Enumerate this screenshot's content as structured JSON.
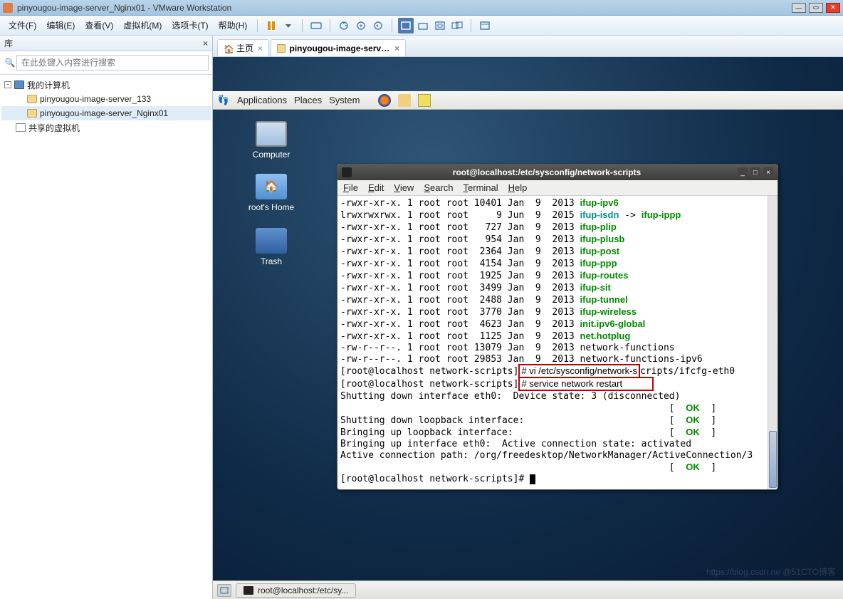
{
  "window": {
    "title": "pinyougou-image-server_Nginx01 - VMware Workstation"
  },
  "menu": {
    "file": "文件(F)",
    "edit": "编辑(E)",
    "view": "查看(V)",
    "vm": "虚拟机(M)",
    "tabs": "选项卡(T)",
    "help": "帮助(H)"
  },
  "sidebar": {
    "header": "库",
    "search_placeholder": "在此处键入内容进行搜索",
    "root": "我的计算机",
    "vm1": "pinyougou-image-server_133",
    "vm2": "pinyougou-image-server_Nginx01",
    "shared": "共享的虚拟机"
  },
  "tabs": {
    "home_label": "主页",
    "vm_label": "pinyougou-image-server..."
  },
  "gnome_panel": {
    "apps": "Applications",
    "places": "Places",
    "system": "System"
  },
  "desktop": {
    "computer": "Computer",
    "home": "root's Home",
    "trash": "Trash"
  },
  "terminal": {
    "title": "root@localhost:/etc/sysconfig/network-scripts",
    "menu": {
      "file": "File",
      "edit": "Edit",
      "view": "View",
      "search": "Search",
      "terminal": "Terminal",
      "help": "Help"
    },
    "listing": [
      {
        "perm": "-rwxr-xr-x.",
        "n": "1",
        "u": "root",
        "g": "root",
        "size": "10401",
        "mon": "Jan",
        "day": " 9",
        "yr": "2013",
        "name": "ifup-ipv6",
        "type": "exec"
      },
      {
        "perm": "lrwxrwxrwx.",
        "n": "1",
        "u": "root",
        "g": "root",
        "size": "    9",
        "mon": "Jun",
        "day": " 9",
        "yr": "2015",
        "name": "ifup-isdn",
        "type": "link",
        "target": "ifup-ippp"
      },
      {
        "perm": "-rwxr-xr-x.",
        "n": "1",
        "u": "root",
        "g": "root",
        "size": "  727",
        "mon": "Jan",
        "day": " 9",
        "yr": "2013",
        "name": "ifup-plip",
        "type": "exec"
      },
      {
        "perm": "-rwxr-xr-x.",
        "n": "1",
        "u": "root",
        "g": "root",
        "size": "  954",
        "mon": "Jan",
        "day": " 9",
        "yr": "2013",
        "name": "ifup-plusb",
        "type": "exec"
      },
      {
        "perm": "-rwxr-xr-x.",
        "n": "1",
        "u": "root",
        "g": "root",
        "size": " 2364",
        "mon": "Jan",
        "day": " 9",
        "yr": "2013",
        "name": "ifup-post",
        "type": "exec"
      },
      {
        "perm": "-rwxr-xr-x.",
        "n": "1",
        "u": "root",
        "g": "root",
        "size": " 4154",
        "mon": "Jan",
        "day": " 9",
        "yr": "2013",
        "name": "ifup-ppp",
        "type": "exec"
      },
      {
        "perm": "-rwxr-xr-x.",
        "n": "1",
        "u": "root",
        "g": "root",
        "size": " 1925",
        "mon": "Jan",
        "day": " 9",
        "yr": "2013",
        "name": "ifup-routes",
        "type": "exec"
      },
      {
        "perm": "-rwxr-xr-x.",
        "n": "1",
        "u": "root",
        "g": "root",
        "size": " 3499",
        "mon": "Jan",
        "day": " 9",
        "yr": "2013",
        "name": "ifup-sit",
        "type": "exec"
      },
      {
        "perm": "-rwxr-xr-x.",
        "n": "1",
        "u": "root",
        "g": "root",
        "size": " 2488",
        "mon": "Jan",
        "day": " 9",
        "yr": "2013",
        "name": "ifup-tunnel",
        "type": "exec"
      },
      {
        "perm": "-rwxr-xr-x.",
        "n": "1",
        "u": "root",
        "g": "root",
        "size": " 3770",
        "mon": "Jan",
        "day": " 9",
        "yr": "2013",
        "name": "ifup-wireless",
        "type": "exec"
      },
      {
        "perm": "-rwxr-xr-x.",
        "n": "1",
        "u": "root",
        "g": "root",
        "size": " 4623",
        "mon": "Jan",
        "day": " 9",
        "yr": "2013",
        "name": "init.ipv6-global",
        "type": "exec"
      },
      {
        "perm": "-rwxr-xr-x.",
        "n": "1",
        "u": "root",
        "g": "root",
        "size": " 1125",
        "mon": "Jan",
        "day": " 9",
        "yr": "2013",
        "name": "net.hotplug",
        "type": "exec"
      },
      {
        "perm": "-rw-r--r--.",
        "n": "1",
        "u": "root",
        "g": "root",
        "size": "13079",
        "mon": "Jan",
        "day": " 9",
        "yr": "2013",
        "name": "network-functions",
        "type": "file"
      },
      {
        "perm": "-rw-r--r--.",
        "n": "1",
        "u": "root",
        "g": "root",
        "size": "29853",
        "mon": "Jan",
        "day": " 9",
        "yr": "2013",
        "name": "network-functions-ipv6",
        "type": "file"
      }
    ],
    "prompt1": "[root@localhost network-scripts]",
    "cmd1_tail": "cripts/ifcfg-eth0",
    "prompt2": "[root@localhost network-scripts]",
    "cmd2": "# service network restart",
    "out1": "Shutting down interface eth0:  Device state: 3 (disconnected)",
    "ok": "OK",
    "out2": "Shutting down loopback interface:",
    "out3": "Bringing up loopback interface:",
    "out4": "Bringing up interface eth0:  Active connection state: activated",
    "out5": "Active connection path: /org/freedesktop/NetworkManager/ActiveConnection/3",
    "prompt3": "[root@localhost network-scripts]# "
  },
  "taskbar": {
    "task1": "root@localhost:/etc/sy..."
  },
  "watermark": "https://blog.csdn.ne @51CTO博客"
}
